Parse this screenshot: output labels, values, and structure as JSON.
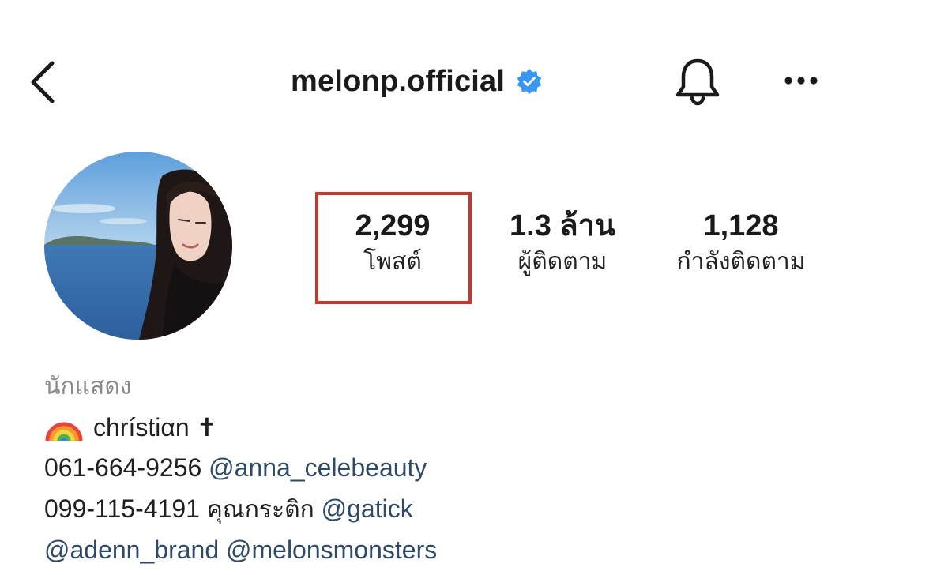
{
  "header": {
    "username": "melonp.official",
    "back_icon": "chevron-left-icon",
    "verified_icon": "verified-badge-icon",
    "bell_icon": "bell-icon",
    "more_icon": "more-horizontal-icon"
  },
  "stats": {
    "posts": {
      "value": "2,299",
      "label": "โพสต์"
    },
    "followers": {
      "value": "1.3 ล้าน",
      "label": "ผู้ติดตาม"
    },
    "following": {
      "value": "1,128",
      "label": "กำลังติดตาม"
    }
  },
  "bio": {
    "category": "นักแสดง",
    "line1": {
      "emoji_icon": "rainbow-icon",
      "text": "chrístiαn ✝"
    },
    "line2": {
      "phone": "061-664-9256",
      "mention": "@anna_celebeauty"
    },
    "line3": {
      "phone": "099-115-4191",
      "text": "คุณกระติก",
      "mention": "@gatick"
    },
    "line4": {
      "mention1": "@adenn_brand",
      "mention2": "@melonsmonsters"
    }
  },
  "colors": {
    "highlight_box": "#c9362b",
    "verified": "#3897f0",
    "mention": "#2f4a66",
    "category": "#8a8a8a"
  }
}
